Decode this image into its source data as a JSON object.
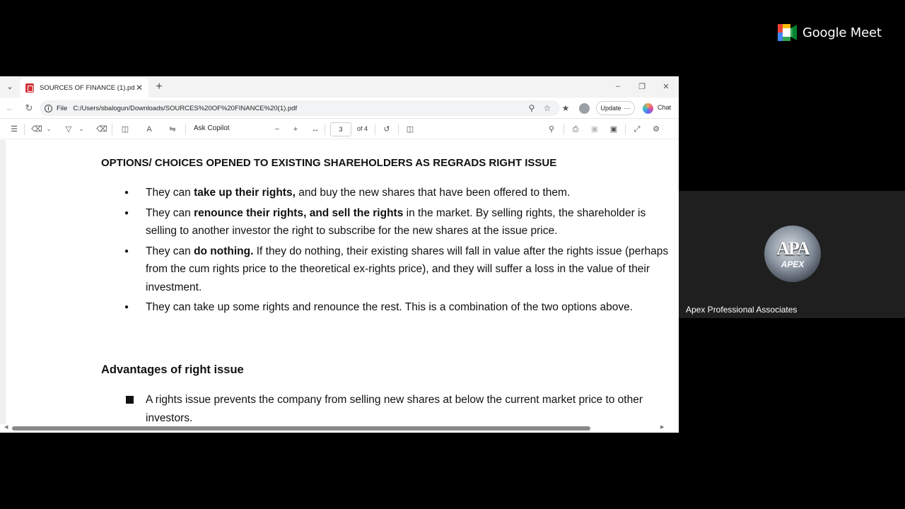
{
  "meet": {
    "brand": "Google Meet",
    "participant_name": "Apex Professional Associates",
    "avatar_text": "APA",
    "avatar_subtext": "APEX"
  },
  "browser": {
    "tab_title": "SOURCES OF FINANCE (1).pdf",
    "url_scheme": "File",
    "url": "C:/Users/sbalogun/Downloads/SOURCES%20OF%20FINANCE%20(1).pdf",
    "update_label": "Update",
    "chat_label": "Chat"
  },
  "pdf_toolbar": {
    "ask_copilot": "Ask Copilot",
    "page_number": "3",
    "page_total": "of 4"
  },
  "document": {
    "heading1": "OPTIONS/ CHOICES OPENED TO EXISTING SHAREHOLDERS AS REGRADS RIGHT ISSUE",
    "bullets": [
      {
        "pre": "They can ",
        "bold": "take up their rights,",
        "post": " and buy the new shares that have been offered to them."
      },
      {
        "pre": "They can ",
        "bold": "renounce their rights, and sell the rights",
        "post": " in the market. By selling rights, the shareholder is selling to another investor the right to subscribe for the new shares at the issue price."
      },
      {
        "pre": "They can ",
        "bold": "do nothing.",
        "post": " If they do nothing, their existing shares will fall in value after the rights issue (perhaps from the cum rights price to the theoretical ex-rights price), and they will suffer a loss in the value of their investment."
      },
      {
        "pre": "They can take up some rights and renounce the rest. This is a combination of the two options above.",
        "bold": "",
        "post": ""
      }
    ],
    "heading2": "Advantages of right issue",
    "advantage1": "A rights issue prevents the company from selling new shares at below the current market price to other investors."
  }
}
